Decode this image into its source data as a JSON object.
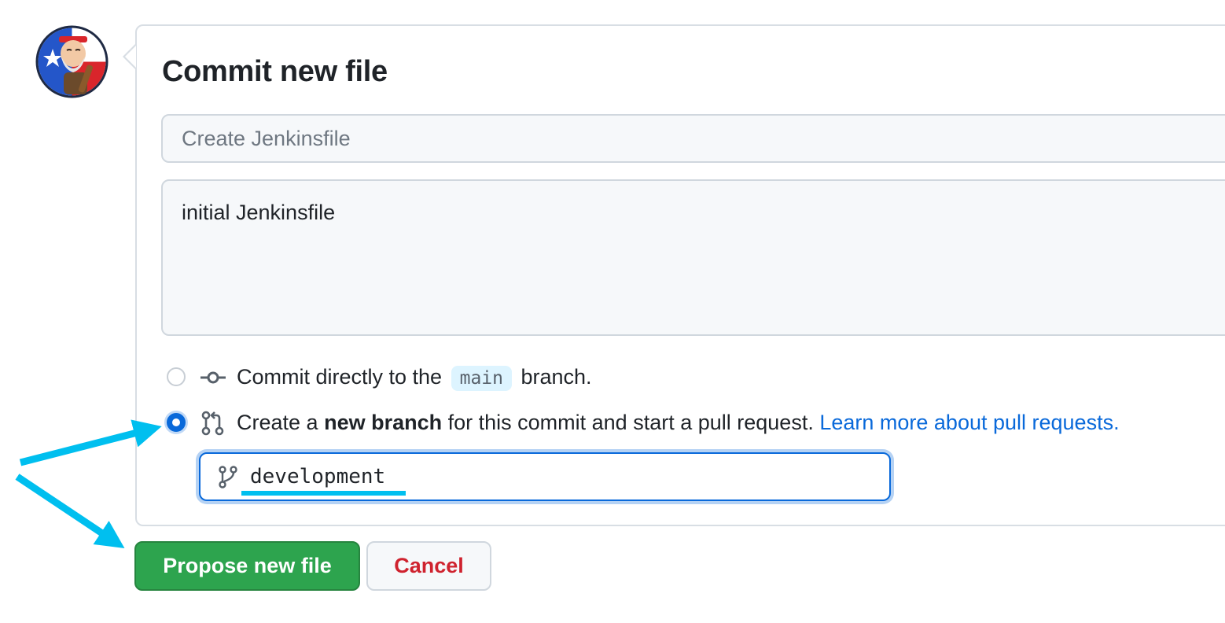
{
  "header": {
    "title": "Commit new file"
  },
  "commit_form": {
    "summary_placeholder": "Create Jenkinsfile",
    "description_value": "initial Jenkinsfile",
    "option_direct": {
      "prefix": "Commit directly to the",
      "branch": "main",
      "suffix": "branch.",
      "selected": false
    },
    "option_new_branch": {
      "prefix": "Create a",
      "bold": "new branch",
      "suffix": "for this commit and start a pull request.",
      "link": "Learn more about pull requests.",
      "selected": true
    },
    "branch_name_value": "development"
  },
  "actions": {
    "propose_label": "Propose new file",
    "cancel_label": "Cancel"
  },
  "colors": {
    "primary_green": "#2da44e",
    "link_blue": "#0969da",
    "danger_red": "#cf222e",
    "annotation_cyan": "#00bfef"
  },
  "icons": {
    "commit": "git-commit-icon",
    "pull_request": "git-pull-request-icon",
    "branch": "git-branch-icon"
  }
}
